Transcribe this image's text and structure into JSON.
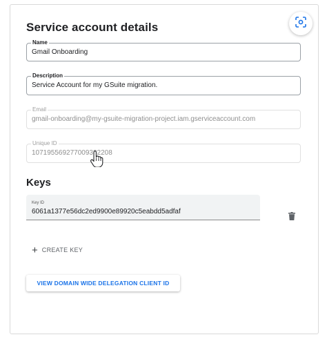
{
  "panel": {
    "title": "Service account details"
  },
  "fields": {
    "name": {
      "label": "Name",
      "value": "Gmail Onboarding"
    },
    "description": {
      "label": "Description",
      "value": "Service Account for my GSuite migration."
    },
    "email": {
      "label": "Email",
      "value": "gmail-onboarding@my-gsuite-migration-project.iam.gserviceaccount.com"
    },
    "unique_id": {
      "label": "Unique ID",
      "value": "107195569277009332208"
    }
  },
  "keys": {
    "heading": "Keys",
    "items": [
      {
        "label": "Key ID",
        "value": "6061a1377e56dc2ed9900e89920c5eabdd5adfaf"
      }
    ],
    "create_label": "CREATE KEY",
    "create_icon": "plus-icon",
    "delete_icon": "trash-icon"
  },
  "delegation": {
    "label": "VIEW DOMAIN WIDE DELEGATION CLIENT ID"
  },
  "scan_icon": "screenshot-scan-icon",
  "colors": {
    "accent": "#1a73e8",
    "text": "#202124",
    "muted": "#8f8f8f",
    "key_bg": "#f1f3f4"
  }
}
